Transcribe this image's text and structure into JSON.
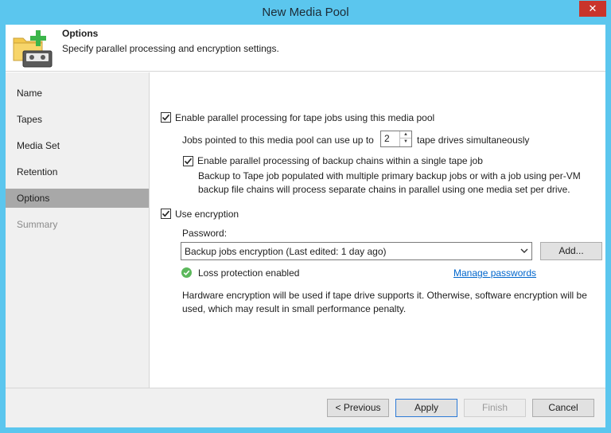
{
  "window": {
    "title": "New Media Pool",
    "close_label": "✕"
  },
  "header": {
    "title": "Options",
    "subtitle": "Specify parallel processing and encryption settings."
  },
  "sidebar": {
    "items": [
      {
        "label": "Name"
      },
      {
        "label": "Tapes"
      },
      {
        "label": "Media Set"
      },
      {
        "label": "Retention"
      },
      {
        "label": "Options"
      },
      {
        "label": "Summary"
      }
    ]
  },
  "parallel": {
    "label": "Enable parallel processing for tape jobs using this media pool",
    "checked": true,
    "drives_prefix": "Jobs pointed to this media pool can use up to",
    "drives_value": "2",
    "drives_suffix": "tape drives simultaneously",
    "chains_label": "Enable parallel processing of backup chains within a single tape job",
    "chains_checked": true,
    "chains_desc_1": "Backup to Tape job populated with multiple primary backup jobs or with a job using per-VM",
    "chains_desc_2": "backup file chains will process separate chains in parallel using one media set per drive."
  },
  "encryption": {
    "label": "Use encryption",
    "checked": true,
    "password_label": "Password:",
    "password_value": "Backup jobs encryption (Last edited: 1 day ago)",
    "add_button": "Add...",
    "loss_protection": "Loss protection enabled",
    "manage_link": "Manage passwords",
    "note_1": "Hardware encryption will be used if tape drive supports it. Otherwise, software encryption will be",
    "note_2": "used, which may result in small performance penalty."
  },
  "footer": {
    "previous": "< Previous",
    "apply": "Apply",
    "finish": "Finish",
    "cancel": "Cancel"
  },
  "colors": {
    "titlebar": "#5bc6ee",
    "close": "#c9342b",
    "active_nav": "#a8a8a8",
    "link": "#0066cc",
    "ok_green": "#5cb85c"
  }
}
